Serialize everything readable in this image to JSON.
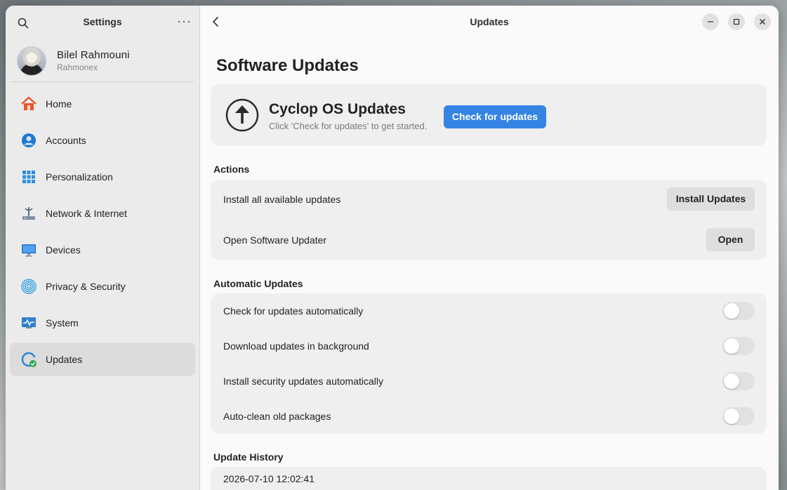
{
  "sidebar": {
    "title": "Settings",
    "search_icon": "search-icon",
    "more_label": "···",
    "profile": {
      "name": "Bilel Rahmouni",
      "username": "Rahmonex"
    },
    "items": [
      {
        "label": "Home",
        "icon": "home-icon"
      },
      {
        "label": "Accounts",
        "icon": "account-icon"
      },
      {
        "label": "Personalization",
        "icon": "grid-icon"
      },
      {
        "label": "Network & Internet",
        "icon": "network-icon"
      },
      {
        "label": "Devices",
        "icon": "monitor-icon"
      },
      {
        "label": "Privacy & Security",
        "icon": "fingerprint-icon"
      },
      {
        "label": "System",
        "icon": "system-icon"
      },
      {
        "label": "Updates",
        "icon": "updates-icon",
        "active": true
      }
    ]
  },
  "header": {
    "title": "Updates"
  },
  "main": {
    "page_title": "Software Updates",
    "update_card": {
      "name": "Cyclop OS Updates",
      "description": "Click 'Check for updates' to get started.",
      "check_button": "Check for updates"
    },
    "actions": {
      "title": "Actions",
      "rows": [
        {
          "label": "Install all available updates",
          "button": "Install Updates"
        },
        {
          "label": "Open Software Updater",
          "button": "Open"
        }
      ]
    },
    "automatic": {
      "title": "Automatic Updates",
      "rows": [
        {
          "label": "Check for updates automatically",
          "enabled": false
        },
        {
          "label": "Download updates in background",
          "enabled": false
        },
        {
          "label": "Install security updates automatically",
          "enabled": false
        },
        {
          "label": "Auto-clean old packages",
          "enabled": false
        }
      ]
    },
    "history": {
      "title": "Update History",
      "entries": [
        {
          "timestamp": "2026-07-10  12:02:41"
        }
      ]
    }
  },
  "colors": {
    "accent": "#3584e4",
    "card": "#efefef",
    "sidebar": "#ebebeb"
  }
}
